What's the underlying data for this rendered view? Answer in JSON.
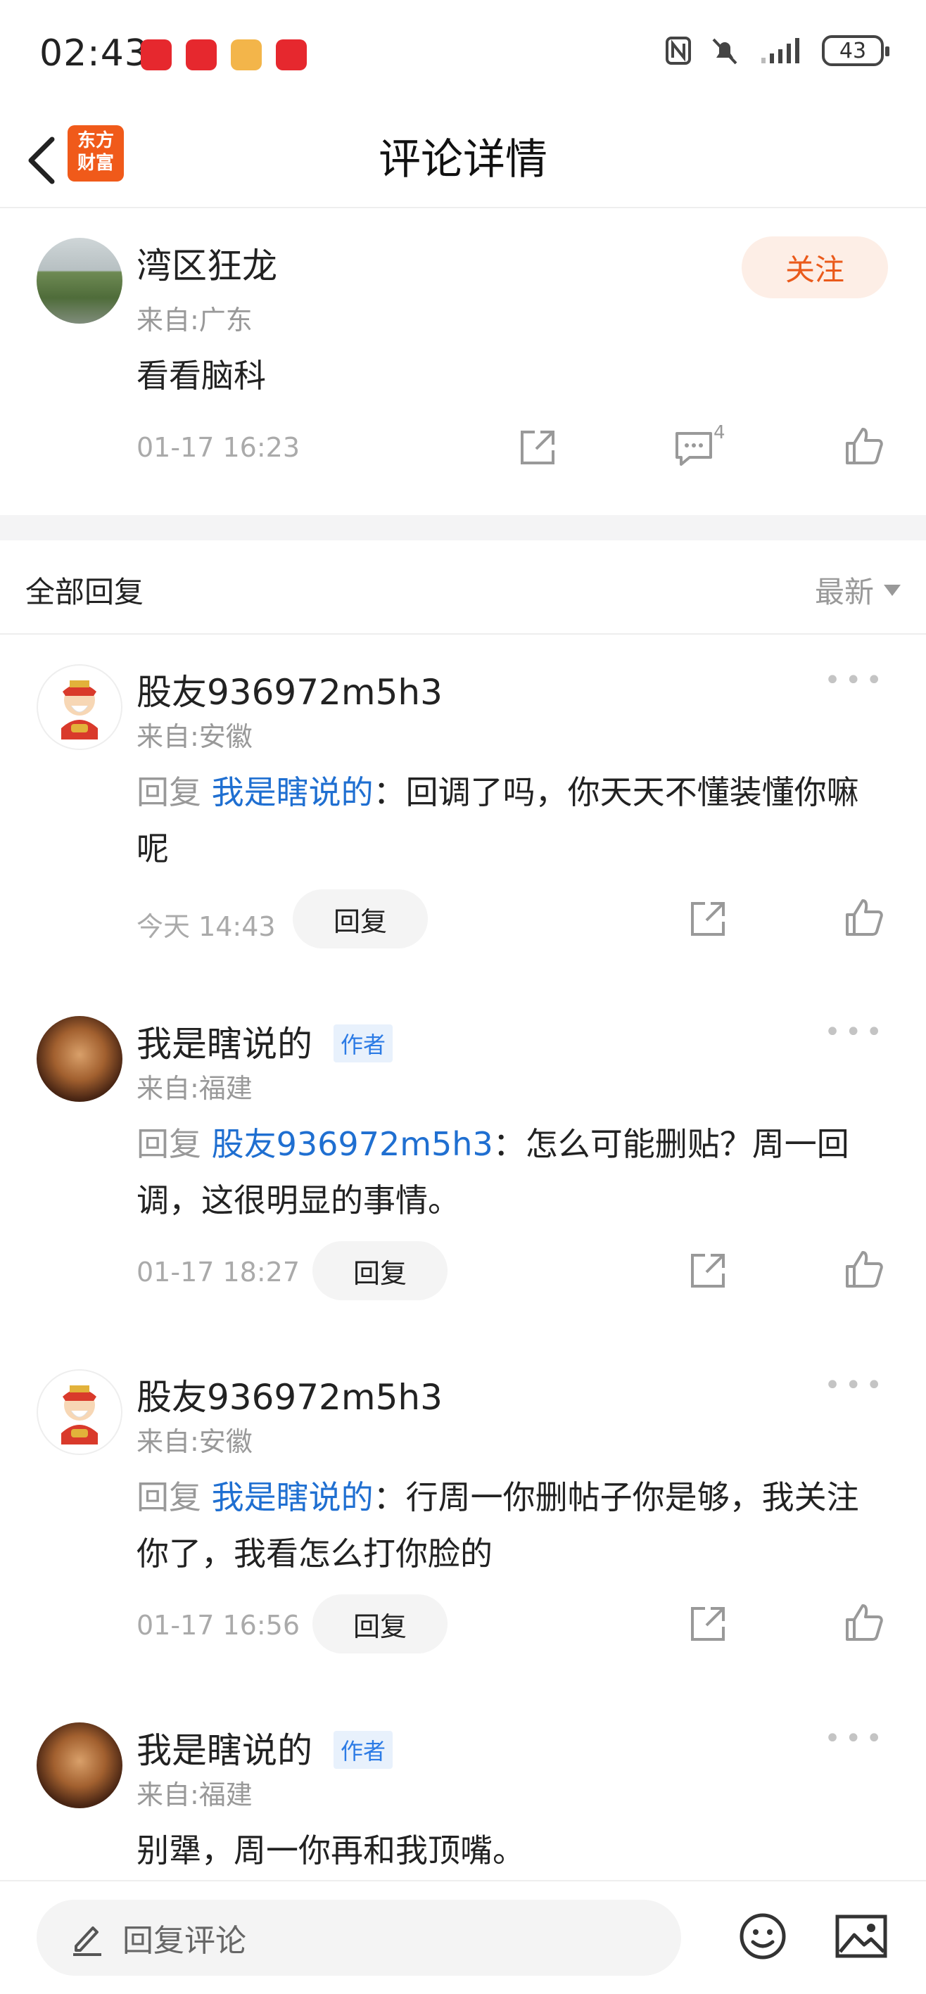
{
  "status_bar": {
    "time": "02:43",
    "battery": "43"
  },
  "header": {
    "title": "评论详情",
    "logo_text": "东方\n财富"
  },
  "main_comment": {
    "user": "湾区狂龙",
    "from": "来自:广东",
    "follow_label": "关注",
    "text": "看看脑科",
    "time": "01-17 16:23",
    "comment_count": "4"
  },
  "section": {
    "title": "全部回复",
    "sort_label": "最新"
  },
  "replies": [
    {
      "user": "股友936972m5h3",
      "from": "来自:安徽",
      "is_author": false,
      "prefix": "回复",
      "target": "我是瞎说的",
      "text": "：回调了吗，你天天不懂装懂你嘛呢",
      "time": "今天 14:43",
      "reply_label": "回复"
    },
    {
      "user": "我是瞎说的",
      "from": "来自:福建",
      "is_author": true,
      "author_label": "作者",
      "prefix": "回复",
      "target": "股友936972m5h3",
      "text": "：怎么可能删贴？周一回调，这很明显的事情。",
      "time": "01-17 18:27",
      "reply_label": "回复"
    },
    {
      "user": "股友936972m5h3",
      "from": "来自:安徽",
      "is_author": false,
      "prefix": "回复",
      "target": "我是瞎说的",
      "text": "：行周一你删帖子你是够，我关注你了，我看怎么打你脸的",
      "time": "01-17 16:56",
      "reply_label": "回复"
    },
    {
      "user": "我是瞎说的",
      "from": "来自:福建",
      "is_author": true,
      "author_label": "作者",
      "text": "别犟，周一你再和我顶嘴。"
    }
  ],
  "bottom_bar": {
    "placeholder": "回复评论"
  },
  "icons": [
    "back-icon",
    "share-icon",
    "comment-icon",
    "like-icon",
    "more-icon",
    "edit-icon",
    "emoji-icon",
    "image-icon"
  ]
}
